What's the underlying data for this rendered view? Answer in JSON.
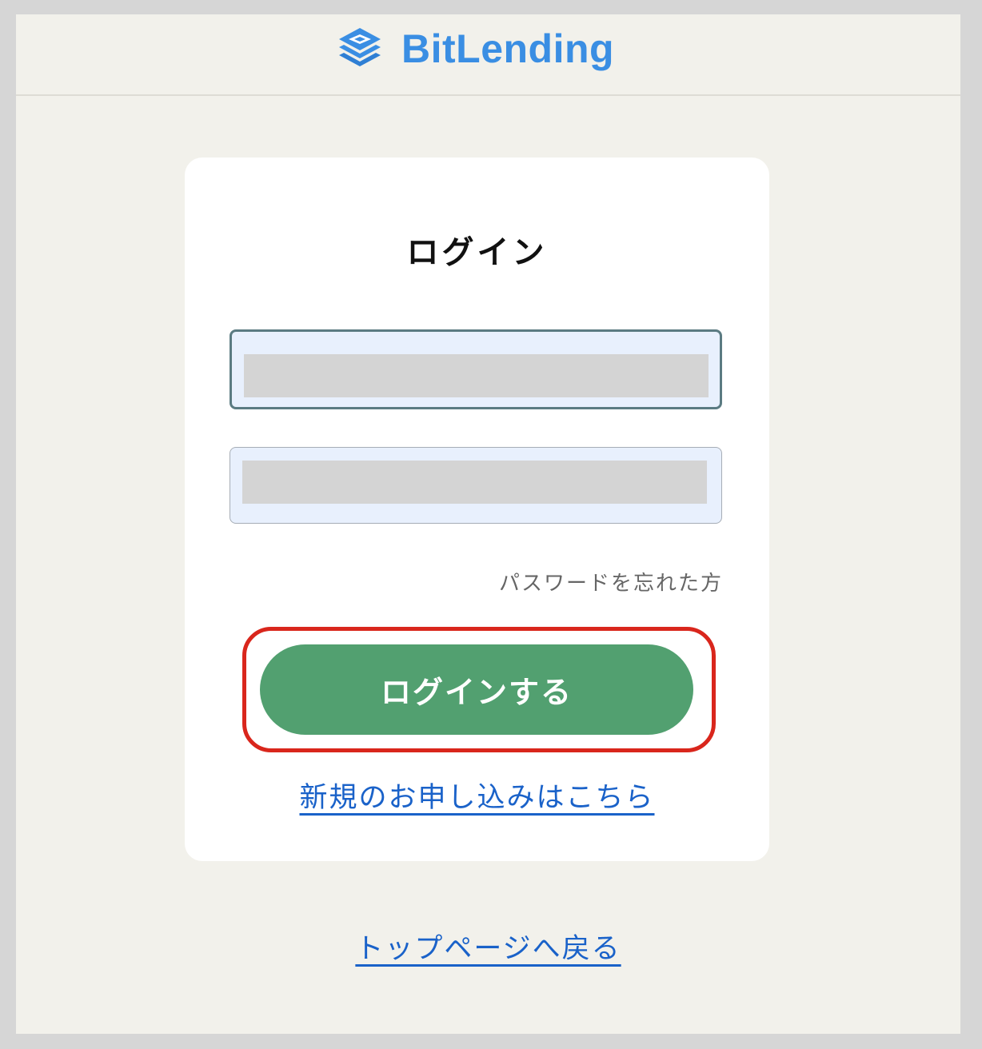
{
  "header": {
    "logo_text": "BitLending",
    "logo_icon": "layers-icon",
    "brand_color": "#3a8ee3"
  },
  "login": {
    "title": "ログイン",
    "email_value": "",
    "password_value": "",
    "forgot_password": "パスワードを忘れた方",
    "submit_label": "ログインする",
    "signup_link": "新規のお申し込みはこちら"
  },
  "footer": {
    "back_to_top": "トップページへ戻る"
  },
  "colors": {
    "background": "#f2f1eb",
    "button": "#52a070",
    "link": "#1a62c9",
    "highlight": "#d9261c",
    "input_bg": "#e8f0fd"
  }
}
